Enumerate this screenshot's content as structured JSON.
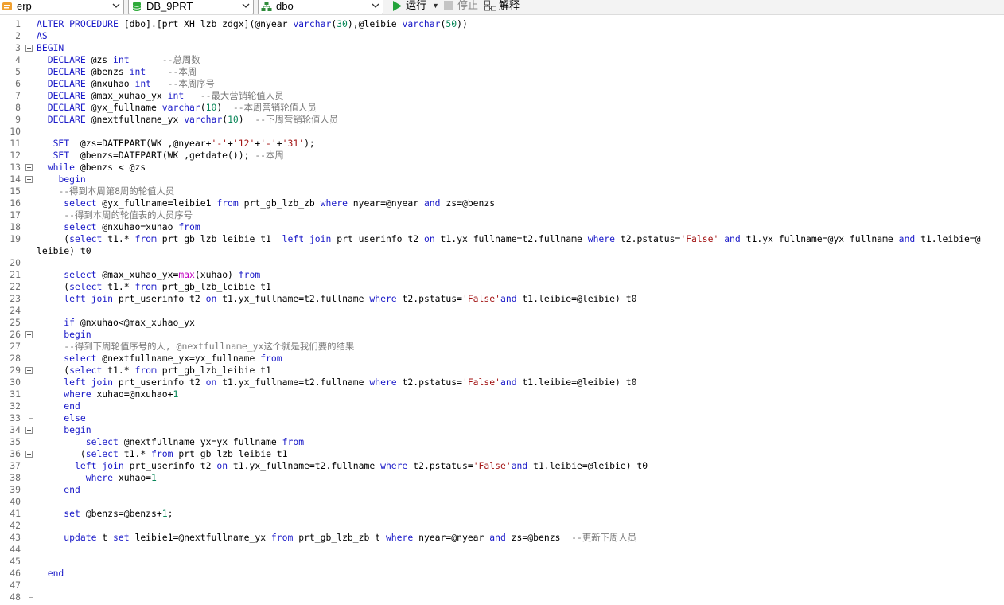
{
  "toolbar": {
    "connection": "erp",
    "database": "DB_9PRT",
    "schema": "dbo",
    "run_label": "运行",
    "stop_label": "停止",
    "explain_label": "解释"
  },
  "editor": {
    "lines": [
      {
        "n": "1",
        "fold": false,
        "guide": "none",
        "t": [
          [
            "kw",
            "ALTER PROCEDURE "
          ],
          [
            "",
            "[dbo].[prt_XH_lzb_zdgx](@nyear "
          ],
          [
            "kw",
            "varchar"
          ],
          [
            "",
            "("
          ],
          [
            "num",
            "30"
          ],
          [
            "",
            "),@leibie "
          ],
          [
            "kw",
            "varchar"
          ],
          [
            "",
            "("
          ],
          [
            "num",
            "50"
          ],
          [
            "",
            "))"
          ]
        ]
      },
      {
        "n": "2",
        "fold": false,
        "guide": "none",
        "t": [
          [
            "kw",
            "AS"
          ]
        ]
      },
      {
        "n": "3",
        "fold": true,
        "guide": "none",
        "caret": true,
        "t": [
          [
            "kw",
            "BEGIN"
          ]
        ]
      },
      {
        "n": "4",
        "fold": false,
        "guide": "line",
        "t": [
          [
            "",
            "  "
          ],
          [
            "kw",
            "DECLARE"
          ],
          [
            "",
            " @zs "
          ],
          [
            "kw",
            "int"
          ],
          [
            "",
            "      "
          ],
          [
            "cm",
            "--总周数"
          ]
        ]
      },
      {
        "n": "5",
        "fold": false,
        "guide": "line",
        "t": [
          [
            "",
            "  "
          ],
          [
            "kw",
            "DECLARE"
          ],
          [
            "",
            " @benzs "
          ],
          [
            "kw",
            "int"
          ],
          [
            "",
            "    "
          ],
          [
            "cm",
            "--本周"
          ]
        ]
      },
      {
        "n": "6",
        "fold": false,
        "guide": "line",
        "t": [
          [
            "",
            "  "
          ],
          [
            "kw",
            "DECLARE"
          ],
          [
            "",
            " @nxuhao "
          ],
          [
            "kw",
            "int"
          ],
          [
            "",
            "   "
          ],
          [
            "cm",
            "--本周序号"
          ]
        ]
      },
      {
        "n": "7",
        "fold": false,
        "guide": "line",
        "t": [
          [
            "",
            "  "
          ],
          [
            "kw",
            "DECLARE"
          ],
          [
            "",
            " @max_xuhao_yx "
          ],
          [
            "kw",
            "int"
          ],
          [
            "",
            "   "
          ],
          [
            "cm",
            "--最大营销轮值人员"
          ]
        ]
      },
      {
        "n": "8",
        "fold": false,
        "guide": "line",
        "t": [
          [
            "",
            "  "
          ],
          [
            "kw",
            "DECLARE"
          ],
          [
            "",
            " @yx_fullname "
          ],
          [
            "kw",
            "varchar"
          ],
          [
            "",
            "("
          ],
          [
            "num",
            "10"
          ],
          [
            "",
            ")  "
          ],
          [
            "cm",
            "--本周营销轮值人员"
          ]
        ]
      },
      {
        "n": "9",
        "fold": false,
        "guide": "line",
        "t": [
          [
            "",
            "  "
          ],
          [
            "kw",
            "DECLARE"
          ],
          [
            "",
            " @nextfullname_yx "
          ],
          [
            "kw",
            "varchar"
          ],
          [
            "",
            "("
          ],
          [
            "num",
            "10"
          ],
          [
            "",
            ")  "
          ],
          [
            "cm",
            "--下周营销轮值人员"
          ]
        ]
      },
      {
        "n": "10",
        "fold": false,
        "guide": "line",
        "t": []
      },
      {
        "n": "11",
        "fold": false,
        "guide": "line",
        "t": [
          [
            "",
            "   "
          ],
          [
            "kw",
            "SET"
          ],
          [
            "",
            "  @zs=DATEPART(WK ,@nyear+"
          ],
          [
            "str",
            "'-'"
          ],
          [
            "",
            "+"
          ],
          [
            "str",
            "'12'"
          ],
          [
            "",
            "+"
          ],
          [
            "str",
            "'-'"
          ],
          [
            "",
            "+"
          ],
          [
            "str",
            "'31'"
          ],
          [
            "",
            ");"
          ]
        ]
      },
      {
        "n": "12",
        "fold": false,
        "guide": "line",
        "t": [
          [
            "",
            "   "
          ],
          [
            "kw",
            "SET"
          ],
          [
            "",
            "  @benzs=DATEPART(WK ,getdate()); "
          ],
          [
            "cm",
            "--本周"
          ]
        ]
      },
      {
        "n": "13",
        "fold": true,
        "guide": "none",
        "t": [
          [
            "",
            "  "
          ],
          [
            "kw",
            "while"
          ],
          [
            "",
            " @benzs < @zs"
          ]
        ]
      },
      {
        "n": "14",
        "fold": true,
        "guide": "none",
        "t": [
          [
            "",
            "    "
          ],
          [
            "kw",
            "begin"
          ]
        ]
      },
      {
        "n": "15",
        "fold": false,
        "guide": "line",
        "t": [
          [
            "",
            "    "
          ],
          [
            "cm",
            "--得到本周第8周的轮值人员"
          ]
        ]
      },
      {
        "n": "16",
        "fold": false,
        "guide": "line",
        "t": [
          [
            "",
            "     "
          ],
          [
            "kw",
            "select"
          ],
          [
            "",
            " @yx_fullname=leibie1 "
          ],
          [
            "kw",
            "from"
          ],
          [
            "",
            " prt_gb_lzb_zb "
          ],
          [
            "kw",
            "where"
          ],
          [
            "",
            " nyear=@nyear "
          ],
          [
            "kw",
            "and"
          ],
          [
            "",
            " zs=@benzs"
          ]
        ]
      },
      {
        "n": "17",
        "fold": false,
        "guide": "line",
        "t": [
          [
            "",
            "     "
          ],
          [
            "cm",
            "--得到本周的轮值表的人员序号"
          ]
        ]
      },
      {
        "n": "18",
        "fold": false,
        "guide": "line",
        "t": [
          [
            "",
            "     "
          ],
          [
            "kw",
            "select"
          ],
          [
            "",
            " @nxuhao=xuhao "
          ],
          [
            "kw",
            "from"
          ]
        ]
      },
      {
        "n": "19",
        "fold": false,
        "guide": "line",
        "t": [
          [
            "",
            "     ("
          ],
          [
            "kw",
            "select"
          ],
          [
            "",
            " t1.* "
          ],
          [
            "kw",
            "from"
          ],
          [
            "",
            " prt_gb_lzb_leibie t1  "
          ],
          [
            "kw",
            "left join"
          ],
          [
            "",
            " prt_userinfo t2 "
          ],
          [
            "kw",
            "on"
          ],
          [
            "",
            " t1.yx_fullname=t2.fullname "
          ],
          [
            "kw",
            "where"
          ],
          [
            "",
            " t2.pstatus="
          ],
          [
            "str",
            "'False'"
          ],
          [
            "",
            "",
            " "
          ],
          [
            "kw",
            "and"
          ],
          [
            "",
            " t1.yx_fullname=@yx_fullname "
          ],
          [
            "kw",
            "and"
          ],
          [
            "",
            " t1.leibie=@"
          ]
        ]
      },
      {
        "n": "",
        "fold": false,
        "guide": "line",
        "wrap": true,
        "t": [
          [
            "",
            "leibie) t0"
          ]
        ]
      },
      {
        "n": "20",
        "fold": false,
        "guide": "line",
        "t": []
      },
      {
        "n": "21",
        "fold": false,
        "guide": "line",
        "t": [
          [
            "",
            "     "
          ],
          [
            "kw",
            "select"
          ],
          [
            "",
            " @max_xuhao_yx="
          ],
          [
            "fn",
            "max"
          ],
          [
            "",
            "(xuhao) "
          ],
          [
            "kw",
            "from"
          ]
        ]
      },
      {
        "n": "22",
        "fold": false,
        "guide": "line",
        "t": [
          [
            "",
            "     ("
          ],
          [
            "kw",
            "select"
          ],
          [
            "",
            " t1.* "
          ],
          [
            "kw",
            "from"
          ],
          [
            "",
            " prt_gb_lzb_leibie t1"
          ]
        ]
      },
      {
        "n": "23",
        "fold": false,
        "guide": "line",
        "t": [
          [
            "",
            "     "
          ],
          [
            "kw",
            "left join"
          ],
          [
            "",
            " prt_userinfo t2 "
          ],
          [
            "kw",
            "on"
          ],
          [
            "",
            " t1.yx_fullname=t2.fullname "
          ],
          [
            "kw",
            "where"
          ],
          [
            "",
            " t2.pstatus="
          ],
          [
            "str",
            "'False'"
          ],
          [
            "kw",
            "and"
          ],
          [
            "",
            " t1.leibie=@leibie) t0"
          ]
        ]
      },
      {
        "n": "24",
        "fold": false,
        "guide": "line",
        "t": []
      },
      {
        "n": "25",
        "fold": false,
        "guide": "line",
        "t": [
          [
            "",
            "     "
          ],
          [
            "kw",
            "if"
          ],
          [
            "",
            " @nxuhao<@max_xuhao_yx"
          ]
        ]
      },
      {
        "n": "26",
        "fold": true,
        "guide": "none",
        "t": [
          [
            "",
            "     "
          ],
          [
            "kw",
            "begin"
          ]
        ]
      },
      {
        "n": "27",
        "fold": false,
        "guide": "line",
        "t": [
          [
            "",
            "     "
          ],
          [
            "cm",
            "--得到下周轮值序号的人, @nextfullname_yx这个就是我们要的结果"
          ]
        ]
      },
      {
        "n": "28",
        "fold": false,
        "guide": "line",
        "t": [
          [
            "",
            "     "
          ],
          [
            "kw",
            "select"
          ],
          [
            "",
            " @nextfullname_yx=yx_fullname "
          ],
          [
            "kw",
            "from"
          ]
        ]
      },
      {
        "n": "29",
        "fold": true,
        "guide": "none",
        "t": [
          [
            "",
            "     ("
          ],
          [
            "kw",
            "select"
          ],
          [
            "",
            " t1.* "
          ],
          [
            "kw",
            "from"
          ],
          [
            "",
            " prt_gb_lzb_leibie t1"
          ]
        ]
      },
      {
        "n": "30",
        "fold": false,
        "guide": "line",
        "t": [
          [
            "",
            "     "
          ],
          [
            "kw",
            "left join"
          ],
          [
            "",
            " prt_userinfo t2 "
          ],
          [
            "kw",
            "on"
          ],
          [
            "",
            " t1.yx_fullname=t2.fullname "
          ],
          [
            "kw",
            "where"
          ],
          [
            "",
            " t2.pstatus="
          ],
          [
            "str",
            "'False'"
          ],
          [
            "kw",
            "and"
          ],
          [
            "",
            " t1.leibie=@leibie) t0"
          ]
        ]
      },
      {
        "n": "31",
        "fold": false,
        "guide": "line",
        "t": [
          [
            "",
            "     "
          ],
          [
            "kw",
            "where"
          ],
          [
            "",
            " xuhao=@nxuhao+"
          ],
          [
            "num",
            "1"
          ]
        ]
      },
      {
        "n": "32",
        "fold": false,
        "guide": "line",
        "t": [
          [
            "",
            "     "
          ],
          [
            "kw",
            "end"
          ]
        ]
      },
      {
        "n": "33",
        "fold": false,
        "guide": "end",
        "t": [
          [
            "",
            "     "
          ],
          [
            "kw",
            "else"
          ]
        ]
      },
      {
        "n": "34",
        "fold": true,
        "guide": "none",
        "t": [
          [
            "",
            "     "
          ],
          [
            "kw",
            "begin"
          ]
        ]
      },
      {
        "n": "35",
        "fold": false,
        "guide": "line",
        "t": [
          [
            "",
            "         "
          ],
          [
            "kw",
            "select"
          ],
          [
            "",
            " @nextfullname_yx=yx_fullname "
          ],
          [
            "kw",
            "from"
          ]
        ]
      },
      {
        "n": "36",
        "fold": true,
        "guide": "none",
        "t": [
          [
            "",
            "        ("
          ],
          [
            "kw",
            "select"
          ],
          [
            "",
            " t1.* "
          ],
          [
            "kw",
            "from"
          ],
          [
            "",
            " prt_gb_lzb_leibie t1"
          ]
        ]
      },
      {
        "n": "37",
        "fold": false,
        "guide": "line",
        "t": [
          [
            "",
            "       "
          ],
          [
            "kw",
            "left join"
          ],
          [
            "",
            " prt_userinfo t2 "
          ],
          [
            "kw",
            "on"
          ],
          [
            "",
            " t1.yx_fullname=t2.fullname "
          ],
          [
            "kw",
            "where"
          ],
          [
            "",
            " t2.pstatus="
          ],
          [
            "str",
            "'False'"
          ],
          [
            "kw",
            "and"
          ],
          [
            "",
            " t1.leibie=@leibie) t0"
          ]
        ]
      },
      {
        "n": "38",
        "fold": false,
        "guide": "line",
        "t": [
          [
            "",
            "         "
          ],
          [
            "kw",
            "where"
          ],
          [
            "",
            " xuhao="
          ],
          [
            "num",
            "1"
          ]
        ]
      },
      {
        "n": "39",
        "fold": false,
        "guide": "end",
        "t": [
          [
            "",
            "     "
          ],
          [
            "kw",
            "end"
          ]
        ]
      },
      {
        "n": "40",
        "fold": false,
        "guide": "line",
        "t": []
      },
      {
        "n": "41",
        "fold": false,
        "guide": "line",
        "t": [
          [
            "",
            "     "
          ],
          [
            "kw",
            "set"
          ],
          [
            "",
            " @benzs=@benzs+"
          ],
          [
            "num",
            "1"
          ],
          [
            "",
            ";"
          ]
        ]
      },
      {
        "n": "42",
        "fold": false,
        "guide": "line",
        "t": []
      },
      {
        "n": "43",
        "fold": false,
        "guide": "line",
        "t": [
          [
            "",
            "     "
          ],
          [
            "kw",
            "update"
          ],
          [
            "",
            " t "
          ],
          [
            "kw",
            "set"
          ],
          [
            "",
            " leibie1=@nextfullname_yx "
          ],
          [
            "kw",
            "from"
          ],
          [
            "",
            " prt_gb_lzb_zb t "
          ],
          [
            "kw",
            "where"
          ],
          [
            "",
            " nyear=@nyear "
          ],
          [
            "kw",
            "and"
          ],
          [
            "",
            " zs=@benzs  "
          ],
          [
            "cm",
            "--更新下周人员"
          ]
        ]
      },
      {
        "n": "44",
        "fold": false,
        "guide": "line",
        "t": []
      },
      {
        "n": "45",
        "fold": false,
        "guide": "line",
        "t": []
      },
      {
        "n": "46",
        "fold": false,
        "guide": "line",
        "t": [
          [
            "",
            "  "
          ],
          [
            "kw",
            "end"
          ]
        ]
      },
      {
        "n": "47",
        "fold": false,
        "guide": "line",
        "t": []
      },
      {
        "n": "48",
        "fold": false,
        "guide": "end",
        "t": []
      }
    ]
  }
}
